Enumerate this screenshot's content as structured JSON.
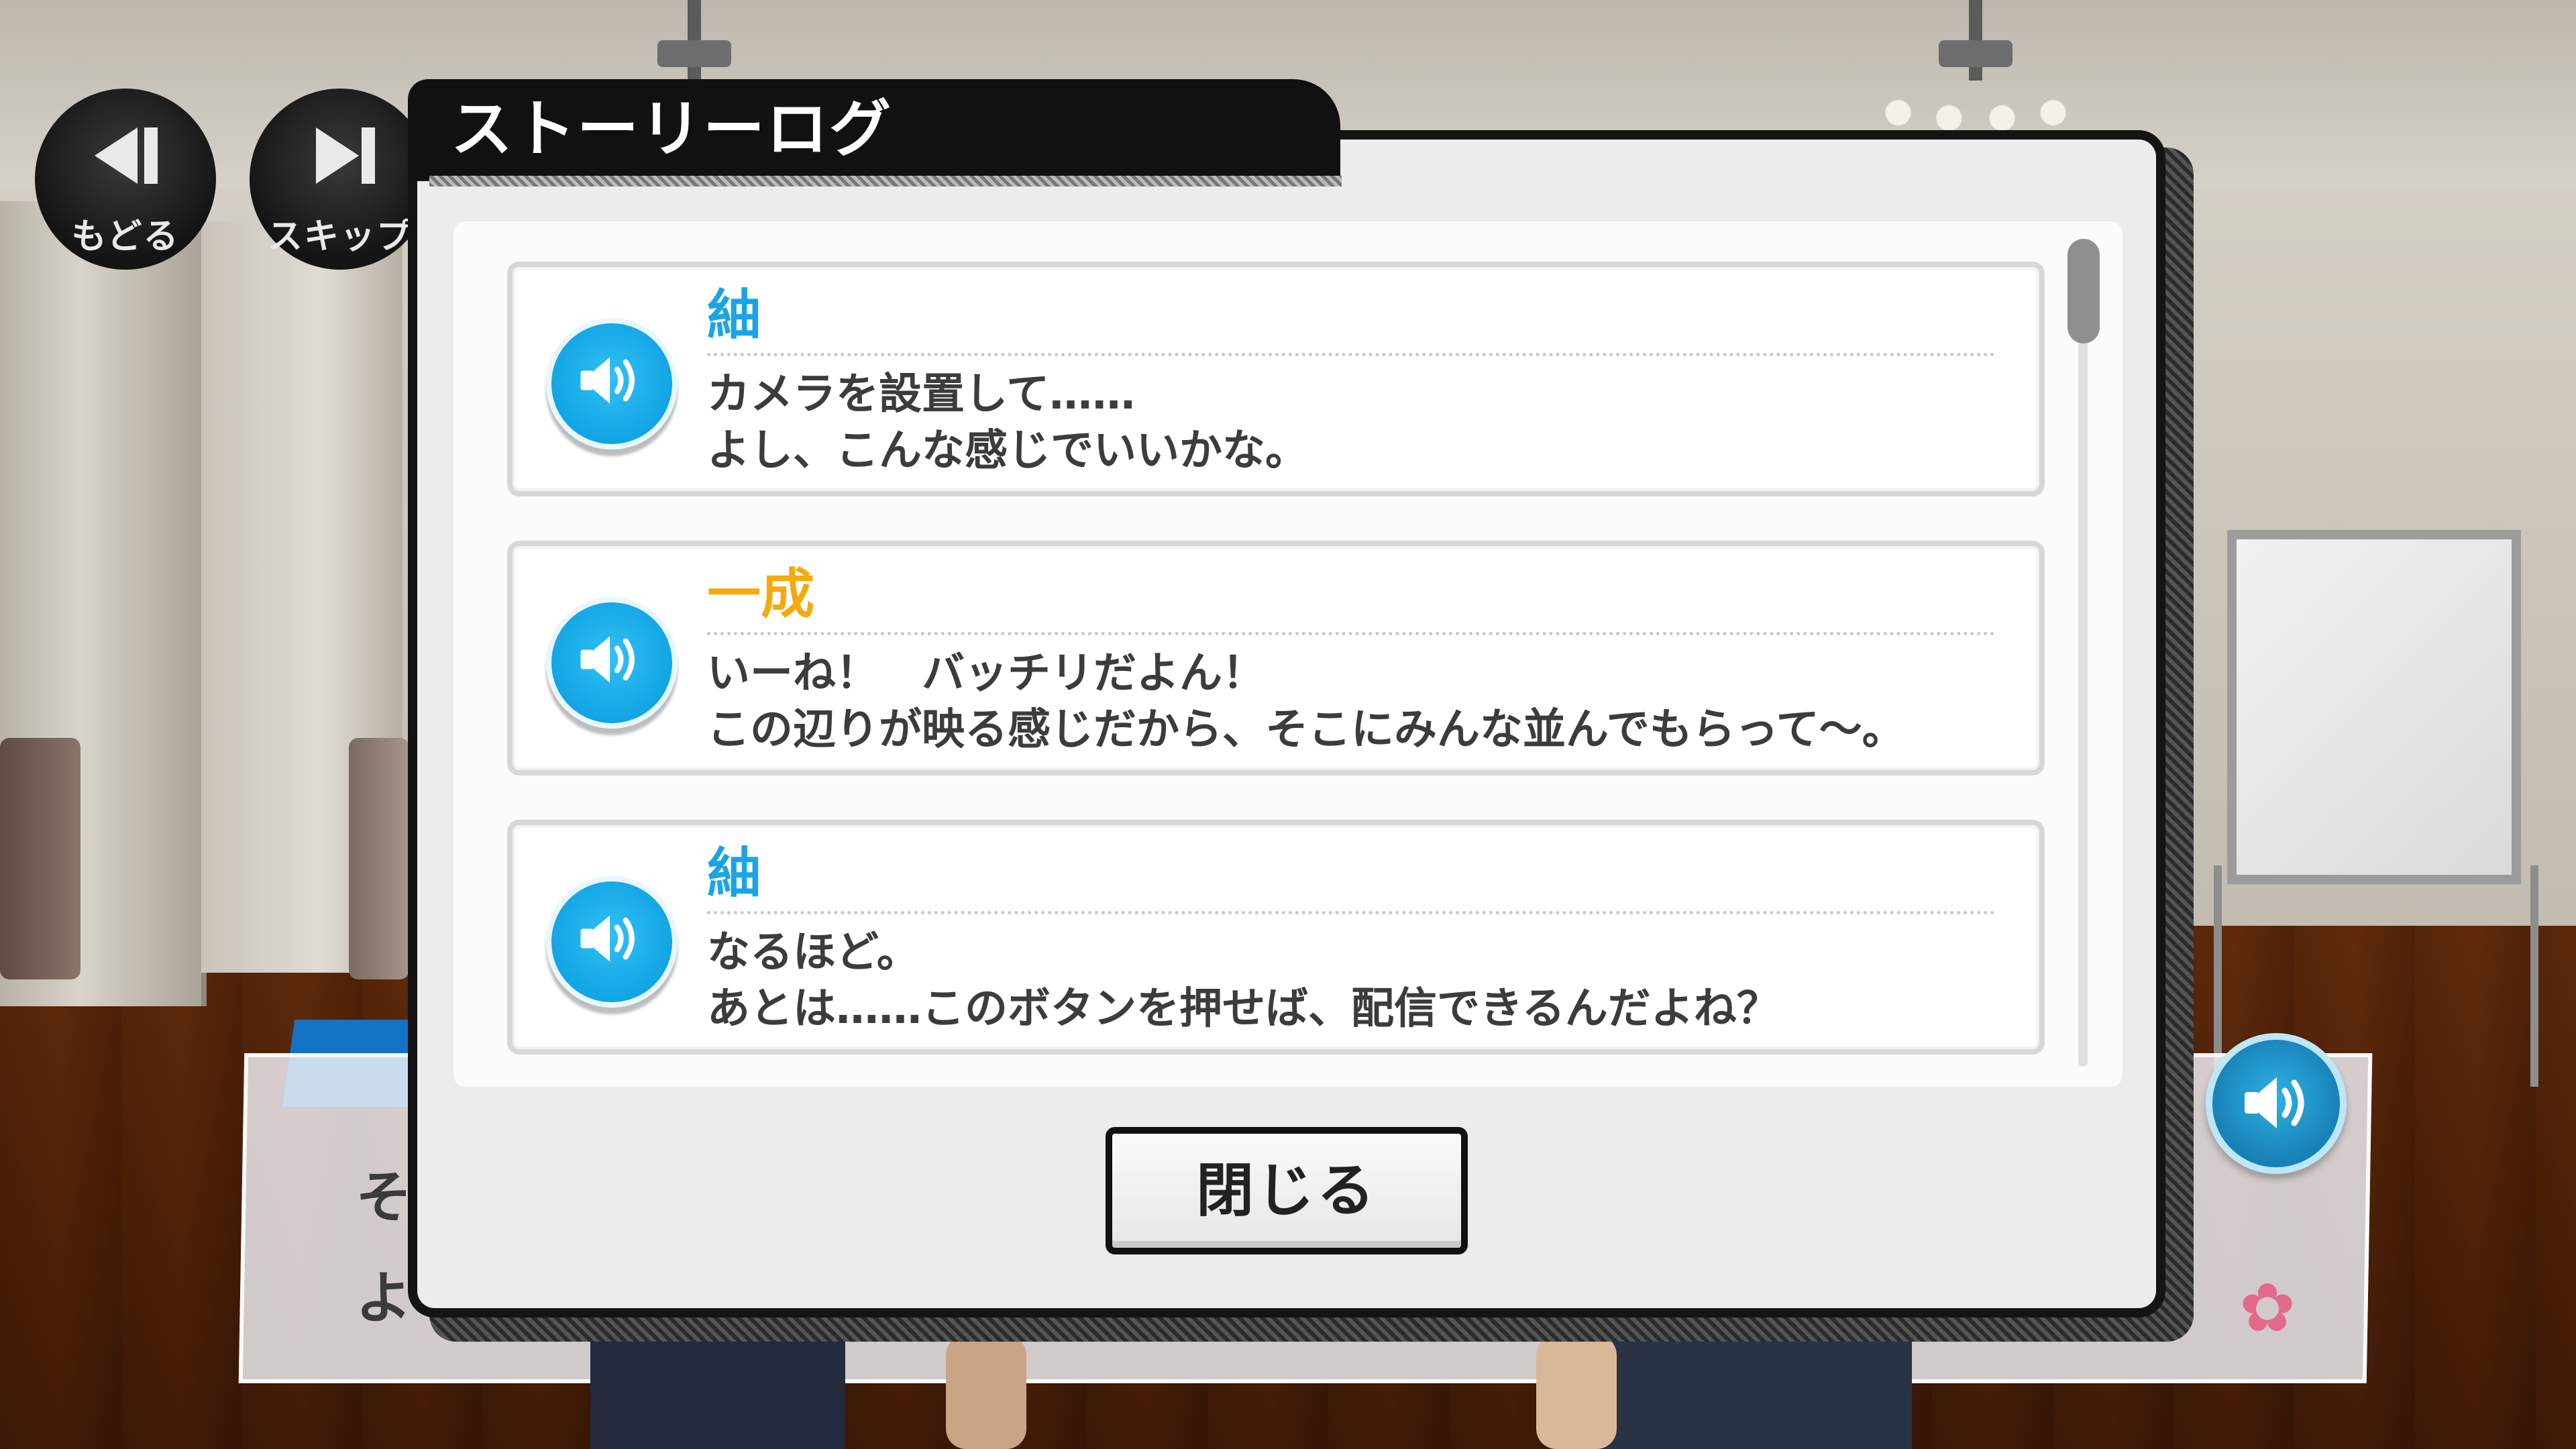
{
  "controls": {
    "back_label": "もどる",
    "skip_label": "スキップ"
  },
  "dialog": {
    "title": "ストーリーログ",
    "close_label": "閉じる"
  },
  "log": {
    "entries": [
      {
        "speaker": "紬",
        "speaker_color": "#1aa4e6",
        "text": "カメラを設置して……\nよし、こんな感じでいいかな。"
      },
      {
        "speaker": "一成",
        "speaker_color": "#f4a90c",
        "text": "いーね！　バッチリだよん！\nこの辺りが映る感じだから、そこにみんな並んでもらって～。"
      },
      {
        "speaker": "紬",
        "speaker_color": "#1aa4e6",
        "text": "なるほど。\nあとは……このボタンを押せば、配信できるんだよね？"
      }
    ]
  },
  "underlying": {
    "text_line1": "そ",
    "text_line2": "よ"
  },
  "icons": {
    "back": "rewind-icon",
    "skip": "skip-forward-icon",
    "voice": "speaker-icon",
    "sakura": "sakura-flower-icon"
  },
  "colors": {
    "accent_blue": "#1aa4e6",
    "accent_orange": "#f4a90c",
    "dialog_border": "#141414"
  }
}
